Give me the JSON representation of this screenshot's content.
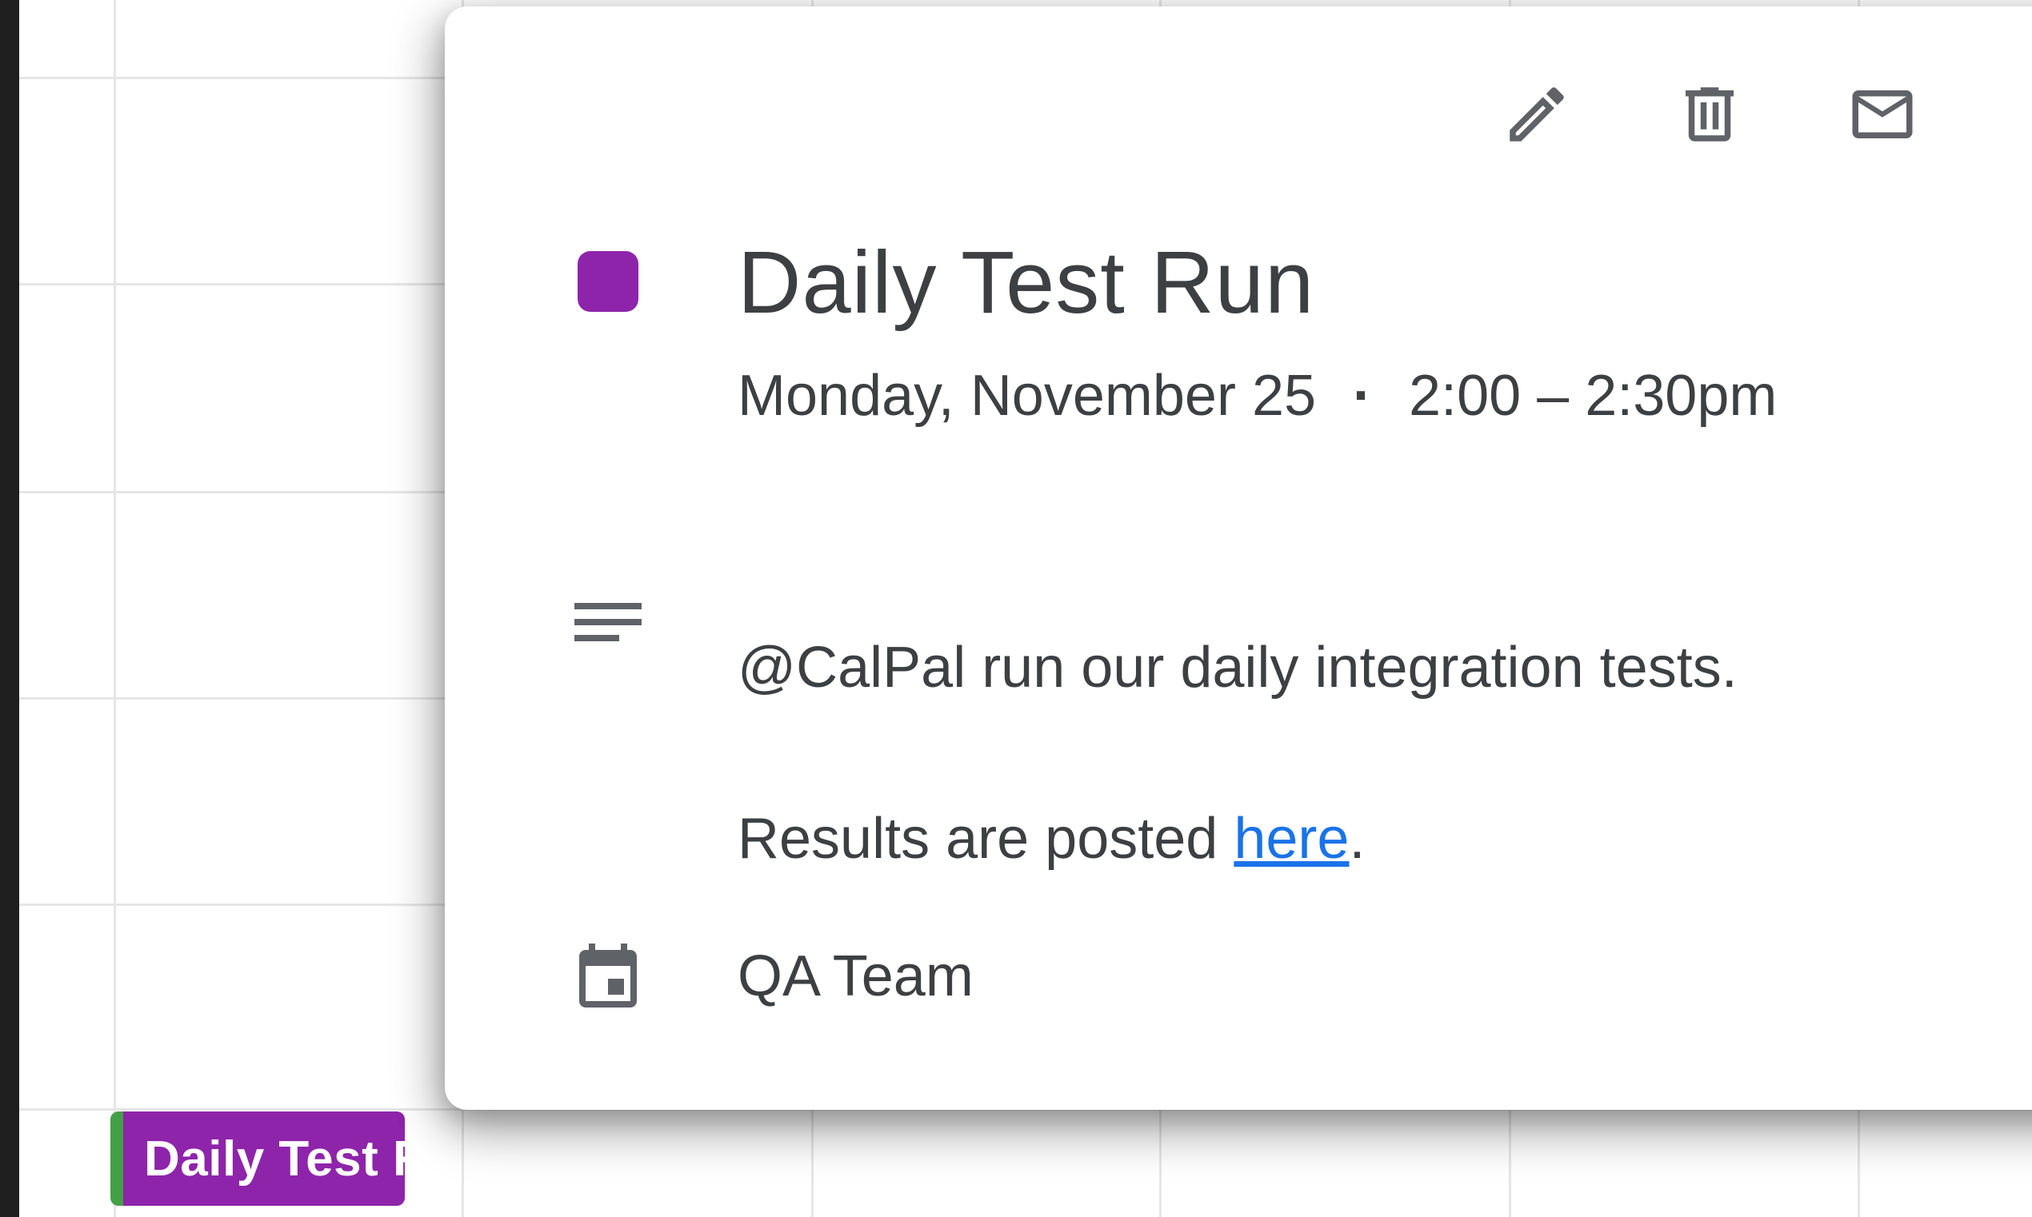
{
  "event_chip": {
    "label": "Daily Test R",
    "color": "#8e24aa",
    "accent_color": "#43a047"
  },
  "popup": {
    "toolbar": {
      "edit_icon": "pencil-icon",
      "delete_icon": "trash-icon",
      "email_icon": "mail-icon"
    },
    "event_color": "#8e24aa",
    "title": "Daily Test Run",
    "date": "Monday, November 25",
    "separator": "·",
    "time": "2:00 – 2:30pm",
    "description": {
      "icon": "notes-icon",
      "line1": "@CalPal run our daily integration tests.",
      "line2_prefix": "Results are posted ",
      "line2_link": "here",
      "line2_suffix": "."
    },
    "calendar": {
      "icon": "calendar-icon",
      "name": "QA Team"
    }
  },
  "colors": {
    "text": "#3c4043",
    "link": "#1a73e8",
    "grid": "#e6e6e6"
  }
}
